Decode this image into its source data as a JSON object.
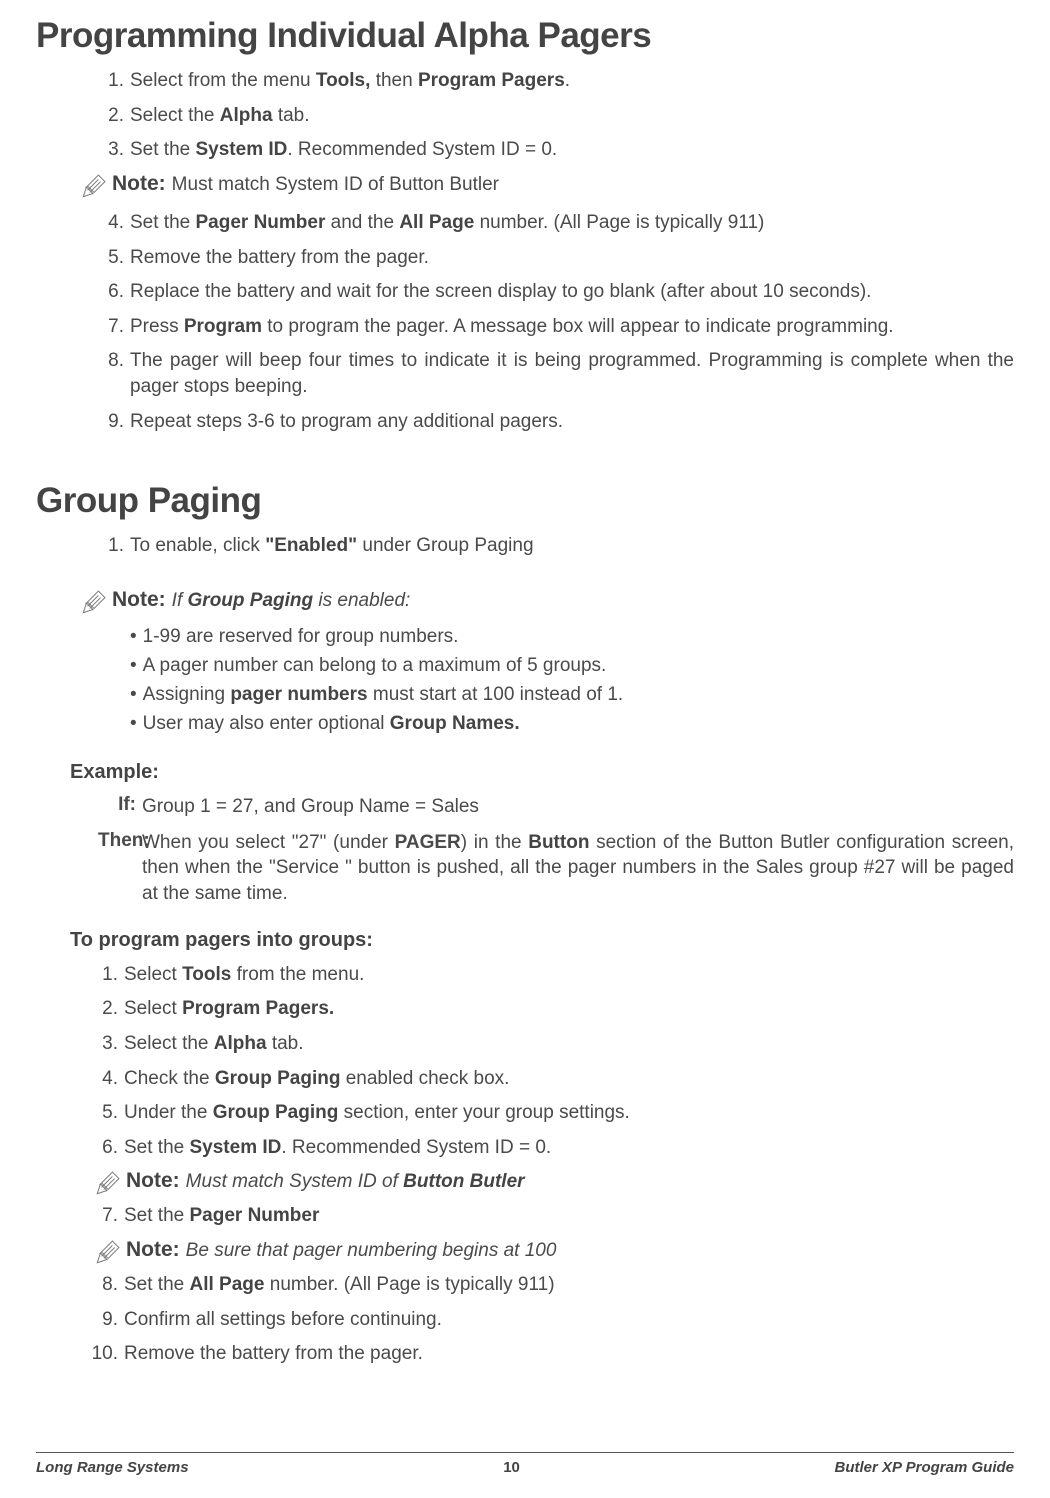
{
  "section1": {
    "title": "Programming Individual Alpha Pagers",
    "steps": [
      {
        "num": "1.",
        "pre": "Select from the menu ",
        "b1": "Tools,",
        "mid": " then ",
        "b2": "Program Pagers",
        "post": "."
      },
      {
        "num": "2.",
        "pre": "Select the ",
        "b1": "Alpha",
        "post": " tab."
      },
      {
        "num": "3.",
        "pre": "Set the ",
        "b1": "System ID",
        "post": ".  Recommended System ID = 0."
      }
    ],
    "note1": {
      "label": "Note:",
      "text": " Must match System ID of Button Butler"
    },
    "steps2": [
      {
        "num": "4.",
        "pre": "Set the ",
        "b1": "Pager Number",
        "mid": " and the ",
        "b2": "All Page",
        "post": " number. (All Page is typically 911)"
      },
      {
        "num": "5.",
        "text": "Remove the battery from the pager."
      },
      {
        "num": "6.",
        "text": "Replace the battery and wait for the screen display to go blank (after about 10 seconds)."
      },
      {
        "num": "7.",
        "pre": "Press ",
        "b1": "Program",
        "post": " to program the pager. A message box will appear to indicate programming."
      },
      {
        "num": "8.",
        "text": "The pager will beep four times to indicate it is being programmed. Programming is complete when the pager stops beeping."
      },
      {
        "num": "9.",
        "text": "Repeat steps 3-6 to program any additional pagers."
      }
    ]
  },
  "section2": {
    "title": "Group Paging",
    "step1": {
      "num": "1.",
      "pre": "To enable, click ",
      "b1": "\"Enabled\"",
      "post": " under Group Paging"
    },
    "note": {
      "label": "Note:",
      "pre": " If ",
      "b1": "Group Paging",
      "post": " is enabled:"
    },
    "bullets": [
      {
        "text": "1-99 are reserved for group numbers."
      },
      {
        "text": "A pager number can belong to a maximum of 5 groups."
      },
      {
        "pre": "Assigning ",
        "b1": "pager numbers",
        "post": " must start at 100 instead of 1."
      },
      {
        "pre": "User may also enter optional ",
        "b1": "Group Names."
      }
    ],
    "example_label": "Example:",
    "if": {
      "label": "If:",
      "text": " Group 1 = 27, and Group Name = Sales"
    },
    "then": {
      "label": "Then:",
      "pre": " When you select \"27\" (under ",
      "b1": "PAGER",
      "mid": ") in the ",
      "b2": "Button",
      "post": " section of the Button Butler configuration screen, then when the \"Service \" button is pushed, all the pager numbers in the Sales group #27 will be paged at the same time."
    },
    "program_label": "To program pagers into groups:",
    "steps": [
      {
        "num": "1.",
        "pre": "Select ",
        "b1": "Tools",
        "post": " from the menu."
      },
      {
        "num": "2.",
        "pre": "Select ",
        "b1": "Program Pagers."
      },
      {
        "num": "3.",
        "pre": "Select the ",
        "b1": "Alpha",
        "post": " tab."
      },
      {
        "num": "4.",
        "pre": "Check the ",
        "b1": "Group Paging",
        "post": " enabled check box."
      },
      {
        "num": "5.",
        "pre": "Under the ",
        "b1": "Group Paging",
        "post": " section, enter your group settings."
      },
      {
        "num": "6.",
        "pre": "Set the ",
        "b1": "System ID",
        "post": ".  Recommended System ID = 0."
      }
    ],
    "note2": {
      "label": "Note:",
      "pre": " Must match System ID of ",
      "b1": "Button Butler"
    },
    "steps2": [
      {
        "num": "7.",
        "pre": "Set the ",
        "b1": "Pager Number"
      }
    ],
    "note3": {
      "label": "Note:",
      "text": " Be sure that pager numbering begins at 100"
    },
    "steps3": [
      {
        "num": "8.",
        "pre": "Set the ",
        "b1": "All Page",
        "post": " number. (All Page is typically 911)"
      },
      {
        "num": "9.",
        "text": "Confirm all settings before continuing."
      },
      {
        "num": "10.",
        "text": "Remove the battery from the pager."
      }
    ]
  },
  "footer": {
    "left": "Long Range Systems",
    "center": "10",
    "right": "Butler XP Program Guide"
  }
}
